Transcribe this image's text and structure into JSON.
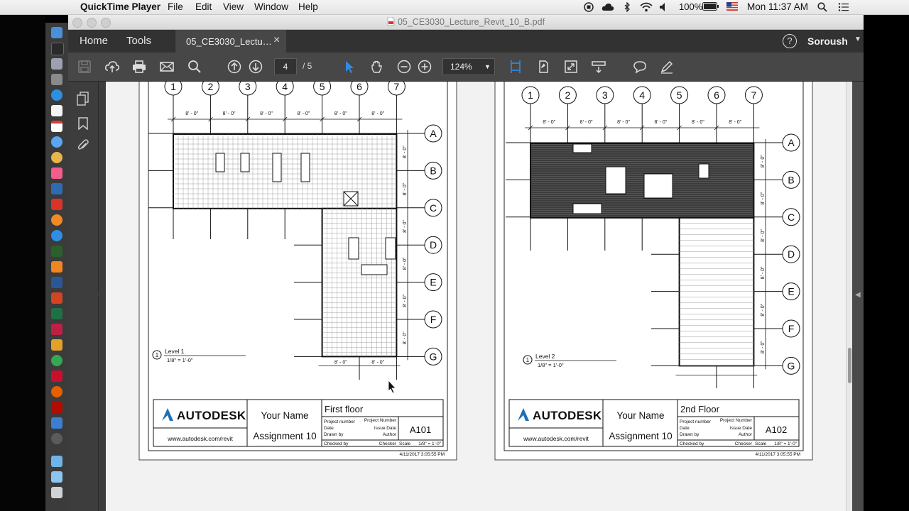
{
  "menubar": {
    "app_name": "QuickTime Player",
    "menus": [
      "File",
      "Edit",
      "View",
      "Window",
      "Help"
    ],
    "battery": "100%",
    "clock": "Mon 11:37 AM"
  },
  "window": {
    "title": "05_CE3030_Lecture_Revit_10_B.pdf"
  },
  "acrobat": {
    "home_tab": "Home",
    "tools_tab": "Tools",
    "doc_tab": "05_CE3030_Lectu…",
    "doc_tab_close": "×",
    "help_icon": "?",
    "user_name": "Soroush"
  },
  "toolbar": {
    "current_page": "4",
    "page_total": "/ 5",
    "zoom": "124%",
    "icons": [
      "save-icon",
      "upload-icon",
      "print-icon",
      "email-icon",
      "search-icon",
      "prev-page-icon",
      "next-page-icon",
      "select-icon",
      "hand-icon",
      "zoom-out-icon",
      "zoom-in-icon",
      "page-display-icon",
      "rotate-icon",
      "full-screen-icon",
      "read-mode-icon",
      "comment-icon",
      "highlight-icon"
    ]
  },
  "sheets": [
    {
      "grid_columns": [
        "1",
        "2",
        "3",
        "4",
        "5",
        "6",
        "7"
      ],
      "grid_rows": [
        "A",
        "B",
        "C",
        "D",
        "E",
        "F",
        "G"
      ],
      "dimension": "8' - 0\"",
      "level_number": "1",
      "level_name": "Level 1",
      "scale_note": "1/8\" = 1'-0\"",
      "company": "AUTODESK",
      "website": "www.autodesk.com/revit",
      "your_name": "Your Name",
      "assignment": "Assignment 10",
      "sheet_title": "First floor",
      "sheet_number": "A101",
      "project_number_label": "Project number",
      "project_number_value": "Project Number",
      "date_label": "Date",
      "date_value": "Issue Date",
      "drawn_label": "Drawn by",
      "drawn_value": "Author",
      "checked_label": "Checked by",
      "checked_value": "Checker",
      "scale_label": "Scale",
      "scale_value": "1/8\" = 1'-0\"",
      "timestamp": "4/11/2017 3:05:55 PM"
    },
    {
      "grid_columns": [
        "1",
        "2",
        "3",
        "4",
        "5",
        "6",
        "7"
      ],
      "grid_rows": [
        "A",
        "B",
        "C",
        "D",
        "E",
        "F",
        "G"
      ],
      "dimension": "8' - 0\"",
      "level_number": "1",
      "level_name": "Level 2",
      "scale_note": "1/8\" = 1'-0\"",
      "company": "AUTODESK",
      "website": "www.autodesk.com/revit",
      "your_name": "Your Name",
      "assignment": "Assignment 10",
      "sheet_title": "2nd Floor",
      "sheet_number": "A102",
      "project_number_label": "Project number",
      "project_number_value": "Project Number",
      "date_label": "Date",
      "date_value": "Issue Date",
      "drawn_label": "Drawn by",
      "drawn_value": "Author",
      "checked_label": "Checked by",
      "checked_value": "Checker",
      "scale_label": "Scale",
      "scale_value": "1/8\" = 1'-0\"",
      "timestamp": "4/11/2017 3:05:55 PM"
    }
  ],
  "colors": {
    "menubar": "#e9e9e9",
    "acrobat_dark": "#323232",
    "toolbar": "#474747",
    "accent_blue": "#2d8ceb",
    "autodesk_blue": "#1e6fb8"
  }
}
